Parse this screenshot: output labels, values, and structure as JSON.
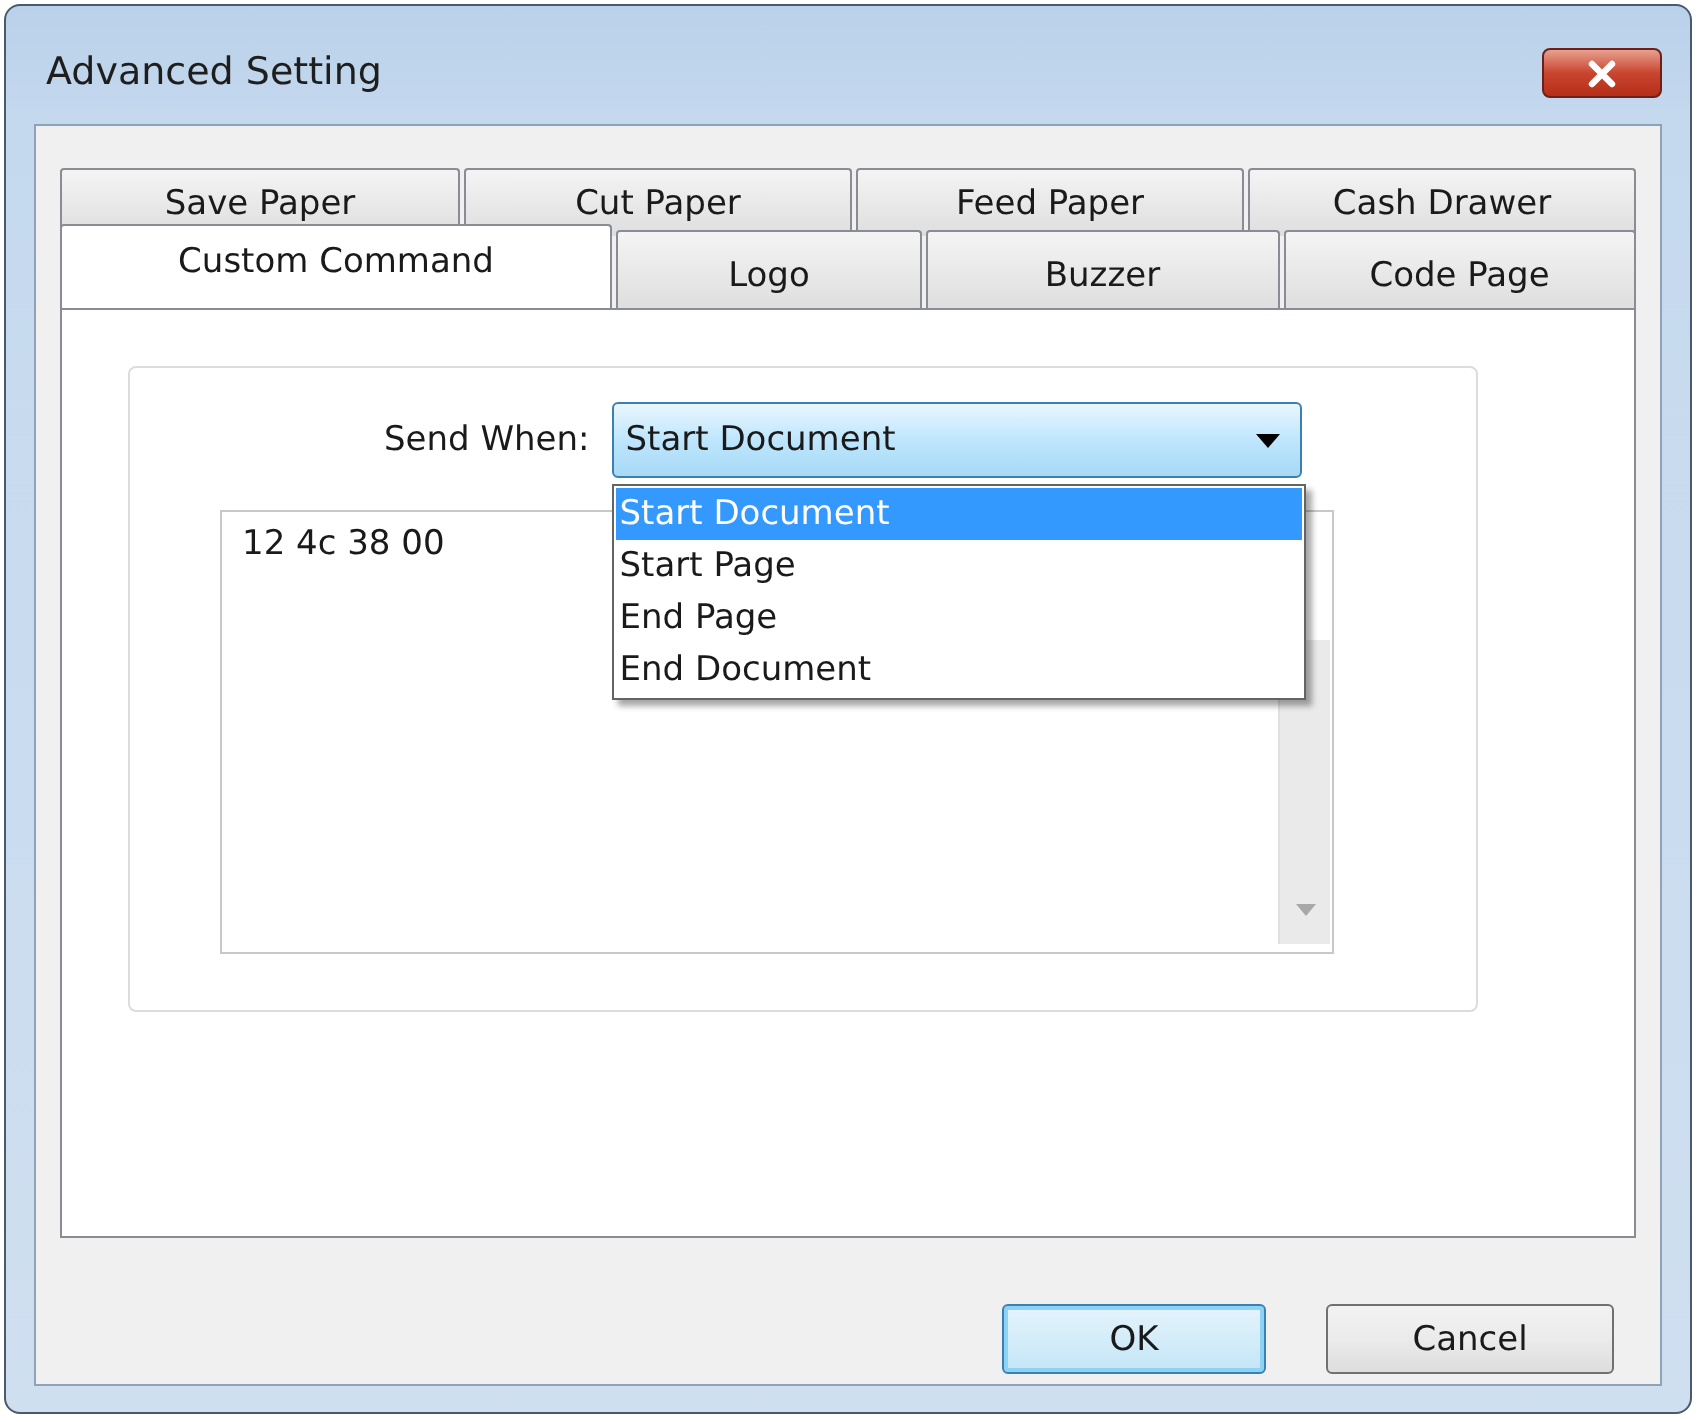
{
  "window": {
    "title": "Advanced Setting"
  },
  "tab_rows": [
    [
      {
        "label": "Save Paper",
        "selected": false
      },
      {
        "label": "Cut Paper",
        "selected": false
      },
      {
        "label": "Feed Paper",
        "selected": false
      },
      {
        "label": "Cash Drawer",
        "selected": false
      }
    ],
    [
      {
        "label": "Custom Command",
        "selected": true
      },
      {
        "label": "Logo",
        "selected": false
      },
      {
        "label": "Buzzer",
        "selected": false
      },
      {
        "label": "Code Page",
        "selected": false
      }
    ]
  ],
  "send_when": {
    "label": "Send When:",
    "value": "Start Document",
    "expanded": true,
    "options": [
      {
        "label": "Start Document",
        "selected": true
      },
      {
        "label": "Start Page",
        "selected": false
      },
      {
        "label": "End Page",
        "selected": false
      },
      {
        "label": "End Document",
        "selected": false
      }
    ]
  },
  "command_text": "12 4c 38 00",
  "buttons": [
    {
      "label": "OK",
      "default": true
    },
    {
      "label": "Cancel",
      "default": false
    }
  ]
}
